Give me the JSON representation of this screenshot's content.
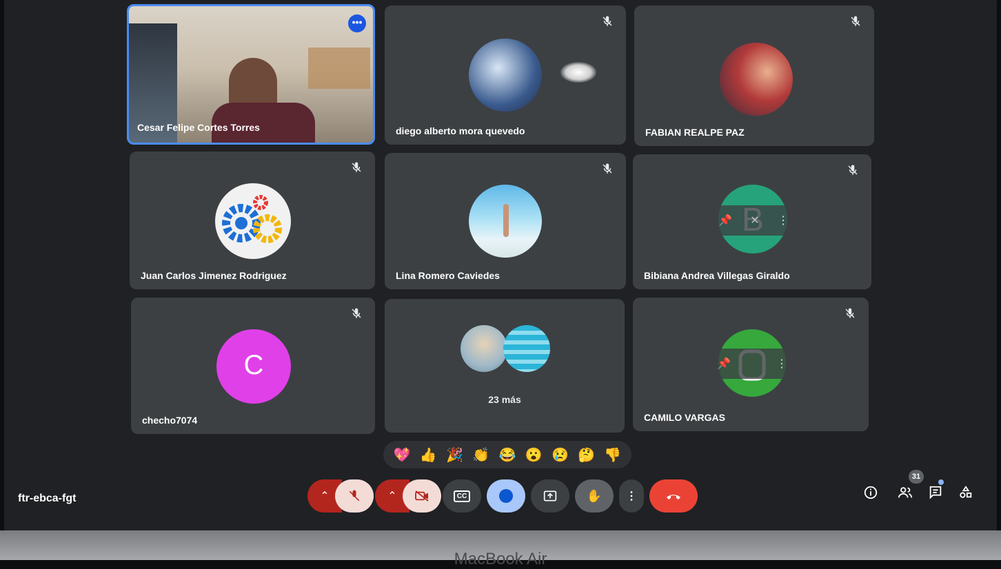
{
  "participants": [
    {
      "name": "Cesar Felipe Cortes Torres"
    },
    {
      "name": "diego alberto mora quevedo"
    },
    {
      "name": "FABIAN REALPE PAZ"
    },
    {
      "name": "Juan Carlos Jimenez Rodriguez"
    },
    {
      "name": "Lina Romero Caviedes"
    },
    {
      "name": "Bibiana Andrea Villegas Giraldo",
      "initial": "B"
    },
    {
      "name": "checho7074",
      "initial": "C"
    },
    {
      "name": "23 más"
    },
    {
      "name": "CAMILO VARGAS"
    }
  ],
  "reactions": [
    "💖",
    "👍",
    "🎉",
    "👏",
    "😂",
    "😮",
    "😢",
    "🤔",
    "👎"
  ],
  "meeting_code": "ftr-ebca-fgt",
  "people_count": "31",
  "colors": {
    "tile": "#3c4043",
    "active_border": "#4a8cf7",
    "end_call": "#ea4335",
    "muted": "#c5221f",
    "bibiana_avatar": "#26a37a",
    "checho_avatar": "#e040e8",
    "camilo_avatar": "#36a83c"
  },
  "bezel_label": "MacBook Air"
}
